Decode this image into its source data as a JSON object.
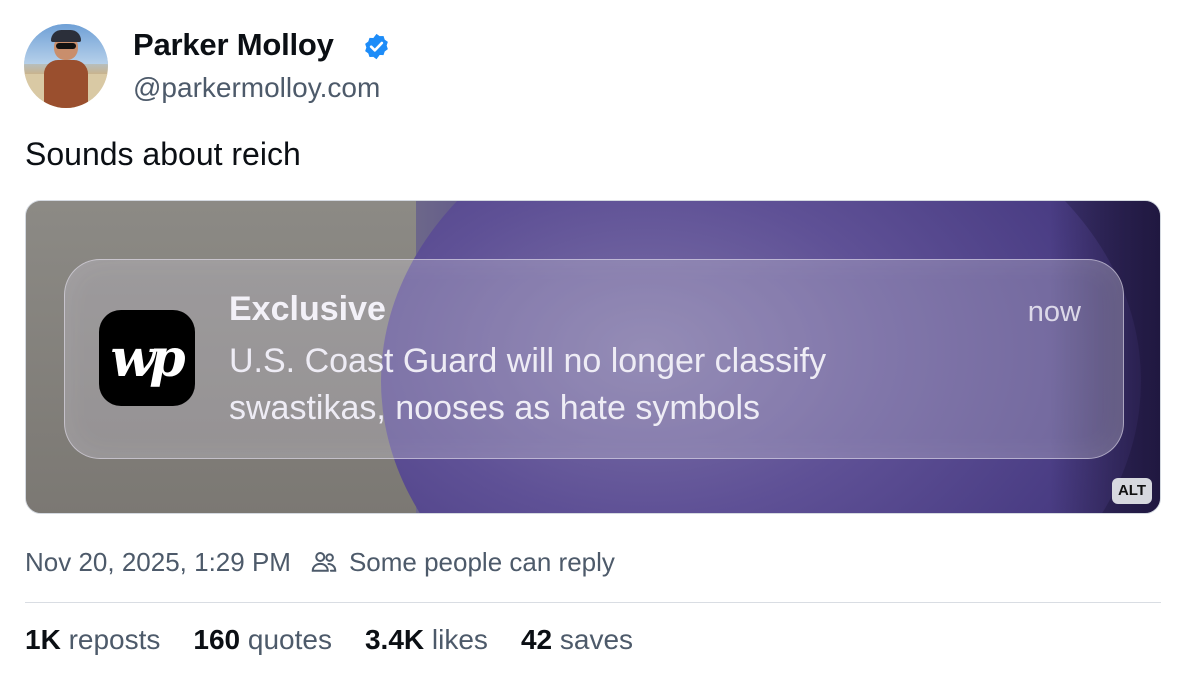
{
  "author": {
    "display_name": "Parker Molloy",
    "handle": "@parkermolloy.com",
    "verified": true
  },
  "post": {
    "text": "Sounds about reich",
    "image": {
      "alt_badge": "ALT",
      "notification": {
        "app_icon_text": "wp",
        "title": "Exclusive",
        "time": "now",
        "body": "U.S. Coast Guard will no longer classify swastikas, nooses as hate symbols"
      }
    },
    "timestamp": "Nov 20, 2025, 1:29 PM",
    "reply_setting": "Some people can reply"
  },
  "stats": [
    {
      "count": "1K",
      "label": "reposts"
    },
    {
      "count": "160",
      "label": "quotes"
    },
    {
      "count": "3.4K",
      "label": "likes"
    },
    {
      "count": "42",
      "label": "saves"
    }
  ],
  "colors": {
    "verified_badge": "#1d8cf8",
    "secondary_text": "#4d5a6a"
  },
  "icons": {
    "verified": "verified-check-icon",
    "reply_setting": "people-icon"
  }
}
